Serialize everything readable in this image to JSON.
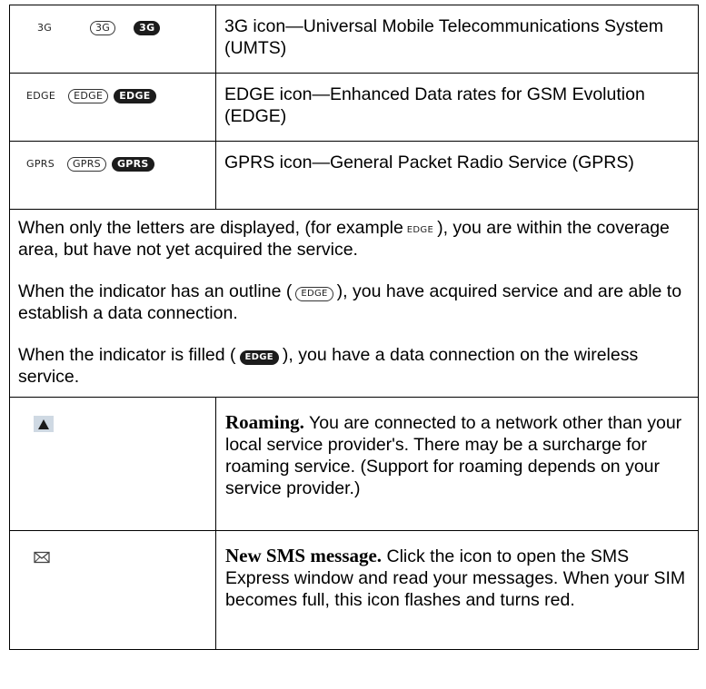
{
  "rows": [
    {
      "plain": "3G",
      "outline": "3G",
      "filled": "3G",
      "desc": "3G icon—Universal Mobile Telecommunications System (UMTS)"
    },
    {
      "plain": "EDGE",
      "outline": "EDGE",
      "filled": "EDGE",
      "desc": "EDGE icon—Enhanced Data rates for GSM Evolution (EDGE)"
    },
    {
      "plain": "GPRS",
      "outline": "GPRS",
      "filled": "GPRS",
      "desc": "GPRS icon—General Packet Radio Service (GPRS)"
    }
  ],
  "notes": {
    "p1_a": "When only the letters are displayed, (for example",
    "p1_glyph": "EDGE",
    "p1_b": "), you are within the coverage area, but have not yet acquired the service.",
    "p2_a": "When the indicator has an outline (",
    "p2_glyph": "EDGE",
    "p2_b": "), you have acquired service and are able to establish a data connection.",
    "p3_a": "When the indicator is filled (",
    "p3_glyph": "EDGE",
    "p3_b": "), you have a data connection on the wireless service."
  },
  "roaming": {
    "icon": "roaming-triangle-icon",
    "title": "Roaming.",
    "text": "You are connected to a network other than your local service provider's. There may be a surcharge for roaming service. (Support for roaming depends on your service provider.)"
  },
  "sms": {
    "icon": "envelope-icon",
    "title": "New SMS message.",
    "text": "Click the icon to open the SMS Express window and read your messages. When your SIM becomes full, this icon flashes and turns red."
  }
}
